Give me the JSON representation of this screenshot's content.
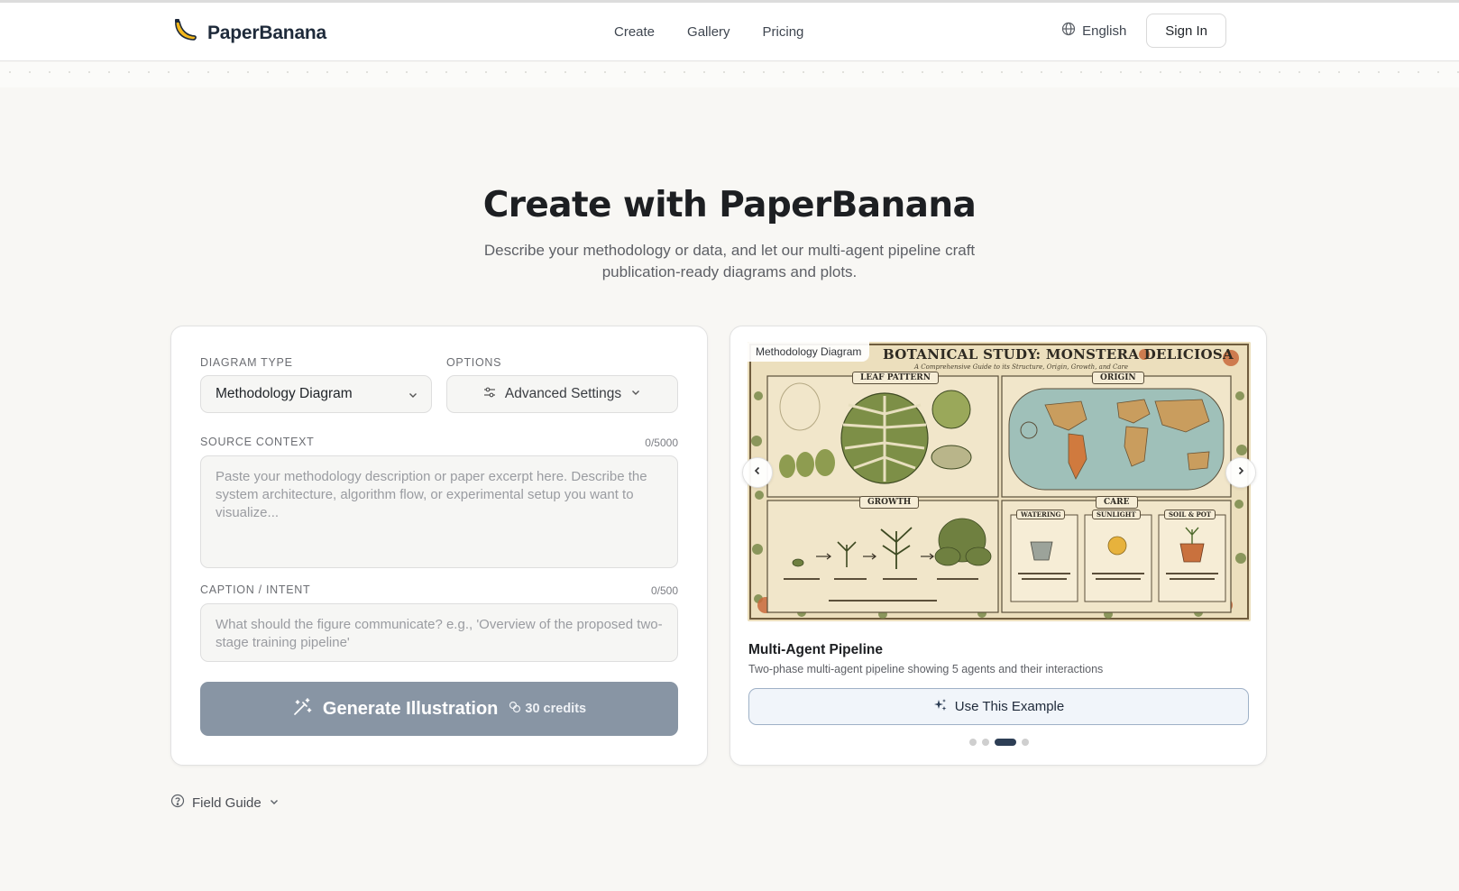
{
  "nav": {
    "brand": "PaperBanana",
    "links": [
      "Create",
      "Gallery",
      "Pricing"
    ],
    "language": "English",
    "sign_in": "Sign In"
  },
  "hero": {
    "title": "Create with PaperBanana",
    "subtitle": "Describe your methodology or data, and let our multi-agent pipeline craft publication-ready diagrams and plots."
  },
  "form": {
    "diagram_type_label": "DIAGRAM TYPE",
    "diagram_type_value": "Methodology Diagram",
    "options_label": "OPTIONS",
    "advanced_settings": "Advanced Settings",
    "source_label": "SOURCE CONTEXT",
    "source_counter": "0/5000",
    "source_placeholder": "Paste your methodology description or paper excerpt here. Describe the system architecture, algorithm flow, or experimental setup you want to visualize...",
    "caption_label": "CAPTION / INTENT",
    "caption_counter": "0/500",
    "caption_placeholder": "What should the figure communicate? e.g., 'Overview of the proposed two-stage training pipeline'",
    "generate_label": "Generate Illustration",
    "credits": "30 credits"
  },
  "example": {
    "badge": "Methodology Diagram",
    "poster_title": "BOTANICAL STUDY: MONSTERA DELICIOSA",
    "poster_subtitle": "A Comprehensive Guide to its Structure, Origin, Growth, and Care",
    "panels": [
      "LEAF PATTERN",
      "ORIGIN",
      "GROWTH",
      "CARE",
      "WATERING",
      "SUNLIGHT",
      "SOIL & POT"
    ],
    "title": "Multi-Agent Pipeline",
    "description": "Two-phase multi-agent pipeline showing 5 agents and their interactions",
    "use_button": "Use This Example",
    "pager": {
      "count": 4,
      "active": 3
    }
  },
  "footer": {
    "field_guide": "Field Guide"
  },
  "colors": {
    "background": "#f8f7f4",
    "generate_button": "#8895a4",
    "pager_active": "#2d3e55",
    "use_button_border": "#9fb1c7"
  }
}
